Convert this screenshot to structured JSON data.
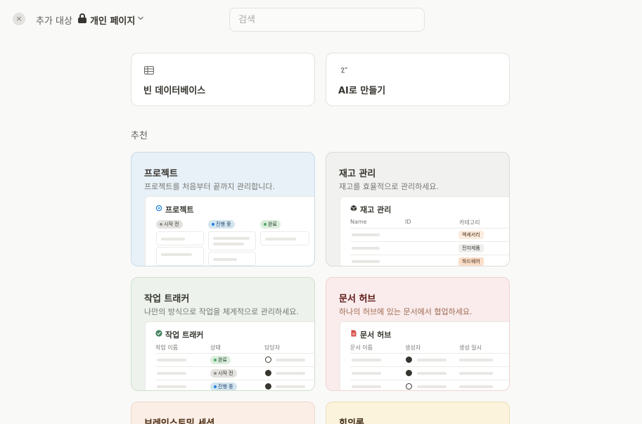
{
  "header": {
    "close_icon": "×",
    "add_to_label": "추가 대상",
    "target_label": "개인 페이지",
    "search_placeholder": "검색"
  },
  "quick_actions": [
    {
      "label": "빈 데이터베이스",
      "icon": "table-icon"
    },
    {
      "label": "AI로 만들기",
      "icon": "ai-face-icon"
    }
  ],
  "section_label": "추천",
  "templates": {
    "project": {
      "title": "프로젝트",
      "desc": "프로젝트를 처음부터 끝까지 관리합니다.",
      "preview_title": "프로젝트",
      "status": [
        "시작 전",
        "진행 중",
        "완료"
      ],
      "accent": "#e8f1f7"
    },
    "inventory": {
      "title": "재고 관리",
      "desc": "재고를 효율적으로 관리하세요.",
      "preview_title": "재고 관리",
      "columns": [
        "Name",
        "ID",
        "카테고리"
      ],
      "tags": [
        "액세서리",
        "전자제품",
        "하드웨어"
      ],
      "accent": "#f1f1ef"
    },
    "task": {
      "title": "작업 트래커",
      "desc": "나만의 방식으로 작업을 체계적으로 관리하세요.",
      "preview_title": "작업 트래커",
      "columns": [
        "작업 이름",
        "상태",
        "담당자"
      ],
      "status": [
        "완료",
        "시작 전",
        "진행 중"
      ],
      "accent": "#edf3ec"
    },
    "docs": {
      "title": "문서 허브",
      "desc": "하나의 허브에 있는 문서에서 협업하세요.",
      "preview_title": "문서 허브",
      "columns": [
        "문서 이름",
        "생성자",
        "생성 일시"
      ],
      "accent": "#faecec"
    },
    "brainstorm": {
      "title": "브레인스토밍 세션"
    },
    "meeting": {
      "title": "회의록"
    }
  }
}
